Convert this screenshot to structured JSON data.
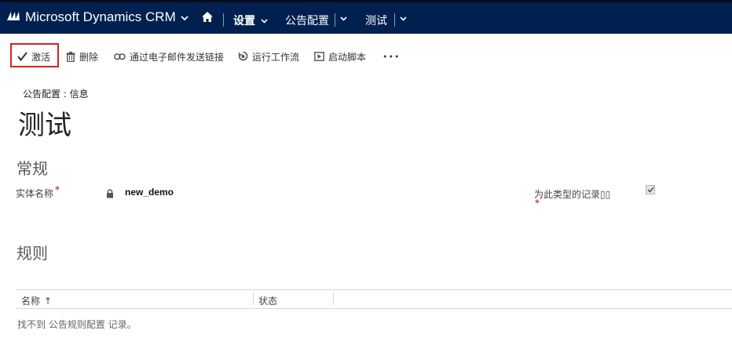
{
  "nav": {
    "app_title": "Microsoft Dynamics CRM",
    "settings_label": "设置",
    "area_label": "公告配置",
    "record_label": "测试"
  },
  "commands": {
    "activate": "激活",
    "delete": "删除",
    "email_link": "通过电子邮件发送链接",
    "run_workflow": "运行工作流",
    "start_dialog": "启动脚本",
    "more": "•••"
  },
  "header": {
    "form_kind": "公告配置 : 信息",
    "title": "测试"
  },
  "general": {
    "section_title": "常规",
    "entity_name_label": "实体名称",
    "entity_name_value": "new_demo",
    "record_type_label": "为此类型的记录▯▯",
    "required_mark": "*",
    "record_type_checked": true
  },
  "rules": {
    "section_title": "规则",
    "columns": [
      "名称",
      "状态"
    ],
    "sort_indicator": "↑",
    "empty_message": "找不到 公告规则配置 记录。"
  },
  "colors": {
    "nav_bg": "#002050",
    "highlight_border": "#d9211f",
    "required": "#cc0000"
  },
  "icons": {
    "logo": "dynamics-logo-icon",
    "home": "home-icon",
    "activate": "checkmark-icon",
    "delete": "trash-icon",
    "email_link": "link-icon",
    "workflow": "workflow-icon",
    "dialog": "play-icon",
    "entity_lock": "lock-icon"
  }
}
